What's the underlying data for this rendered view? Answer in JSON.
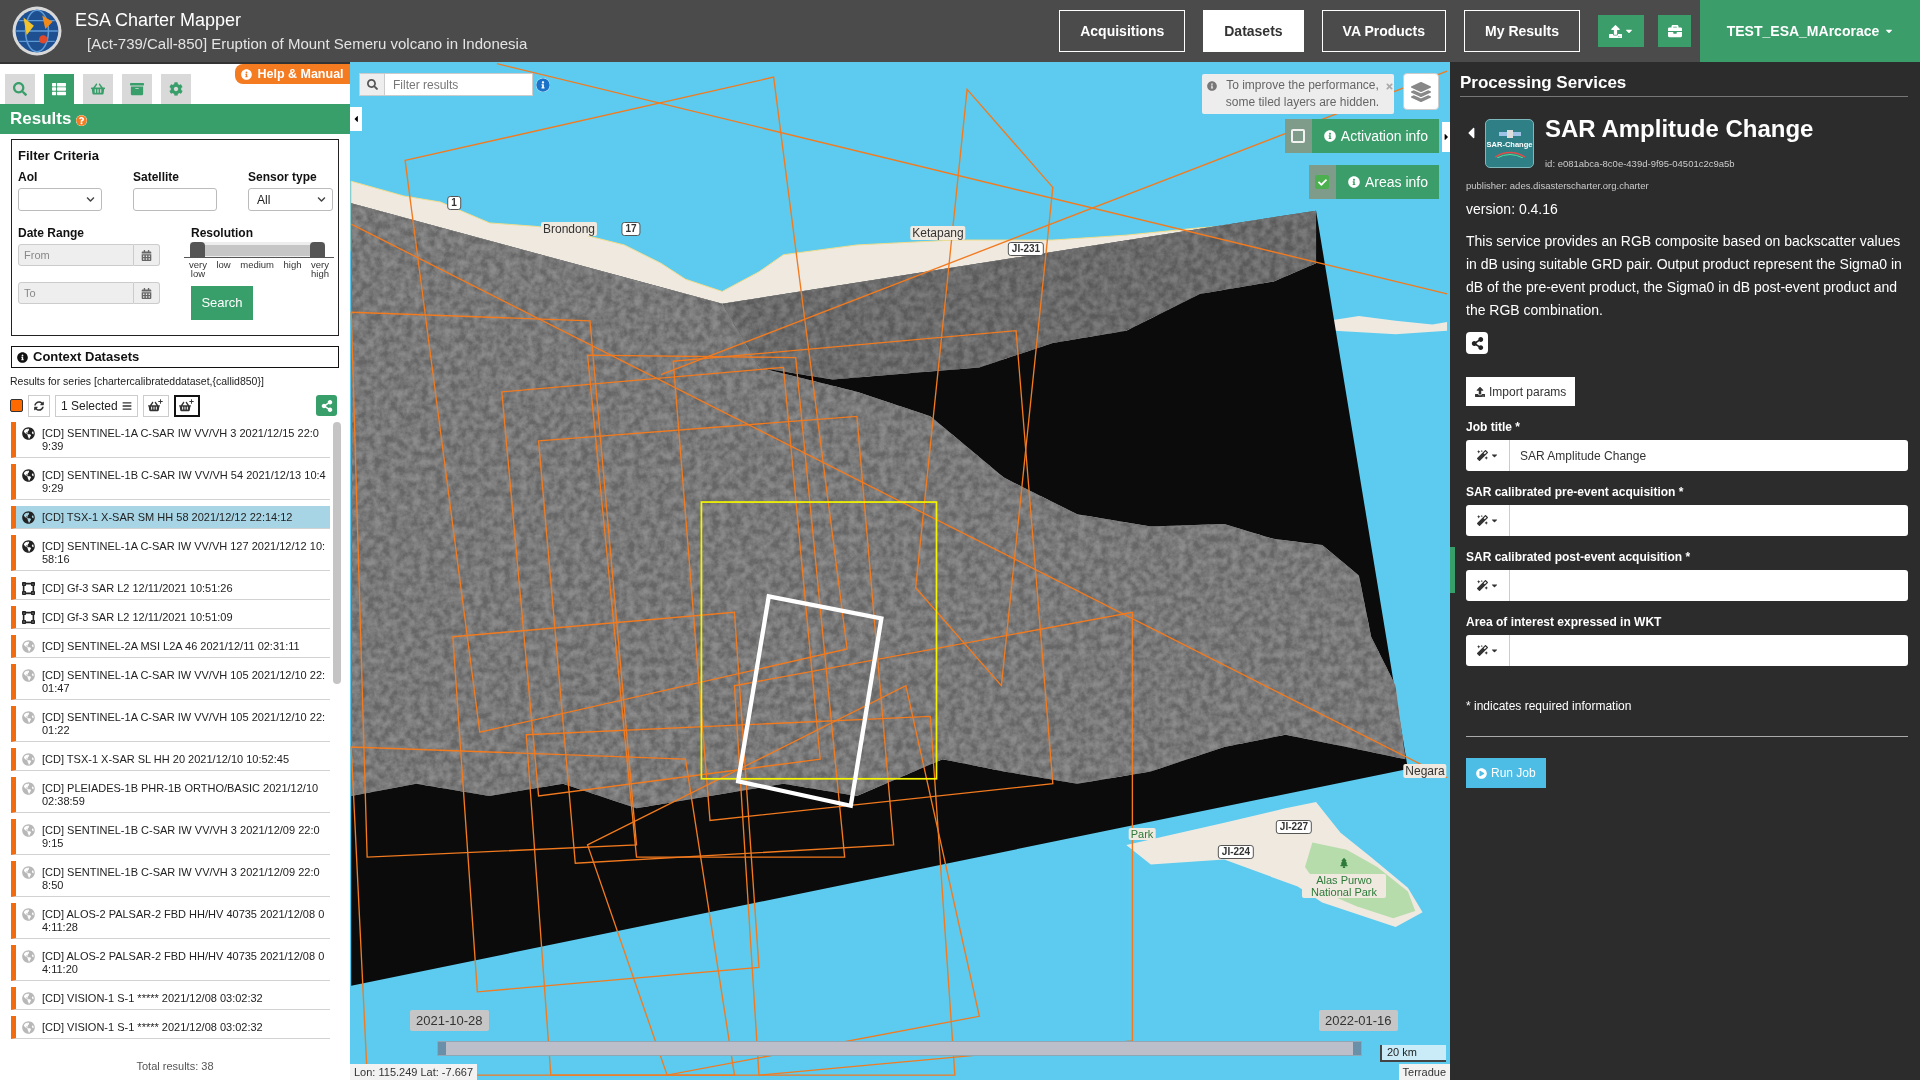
{
  "header": {
    "title": "ESA Charter Mapper",
    "subtitle": "[Act-739/Call-850] Eruption of Mount Semeru volcano in Indonesia",
    "nav": [
      {
        "label": "Acquisitions",
        "selected": false
      },
      {
        "label": "Datasets",
        "selected": true
      },
      {
        "label": "VA Products",
        "selected": false
      },
      {
        "label": "My Results",
        "selected": false
      }
    ],
    "user": "TEST_ESA_MArcorace"
  },
  "sidebar": {
    "help": "Help & Manual",
    "tabs": [
      {
        "kind": "search",
        "selected": false
      },
      {
        "kind": "list",
        "selected": true
      },
      {
        "kind": "basket",
        "selected": false
      },
      {
        "kind": "archive",
        "selected": false
      },
      {
        "kind": "settings",
        "selected": false
      }
    ],
    "heading": "Results",
    "filter": {
      "title": "Filter Criteria",
      "aoi": {
        "label": "AoI"
      },
      "satellite": {
        "label": "Satellite"
      },
      "sensor": {
        "label": "Sensor type",
        "value": "All"
      },
      "date_range": {
        "label": "Date Range",
        "from_placeholder": "From",
        "to_placeholder": "To"
      },
      "resolution": {
        "label": "Resolution",
        "level": 1,
        "ticks": [
          "very low",
          "low",
          "medium",
          "high",
          "very high"
        ]
      },
      "search_button": "Search"
    },
    "results": {
      "title": "Context Datasets",
      "series": "Results for series [chartercalibrateddataset,{callid850}]",
      "selected_count": "1 Selected",
      "basket_buttons": [
        {
          "focused": false
        },
        {
          "focused": true
        }
      ],
      "items": [
        {
          "text": "[CD] SENTINEL-1A C-SAR IW VV/VH 3 2021/12/15 22:09:39",
          "kind": "globe",
          "dimmed": false,
          "selected": false
        },
        {
          "text": "[CD] SENTINEL-1B C-SAR IW VV/VH 54 2021/12/13 10:49:29",
          "kind": "globe",
          "dimmed": false,
          "selected": false
        },
        {
          "text": "[CD] TSX-1 X-SAR SM HH 58 2021/12/12 22:14:12",
          "kind": "globe",
          "dimmed": false,
          "selected": true
        },
        {
          "text": "[CD] SENTINEL-1A C-SAR IW VV/VH 127 2021/12/12 10:58:16",
          "kind": "globe",
          "dimmed": false,
          "selected": false
        },
        {
          "text": "[CD] Gf-3 SAR L2 12/11/2021 10:51:26",
          "kind": "frame",
          "dimmed": false,
          "selected": false
        },
        {
          "text": "[CD] Gf-3 SAR L2 12/11/2021 10:51:09",
          "kind": "frame",
          "dimmed": false,
          "selected": false
        },
        {
          "text": "[CD] SENTINEL-2A MSI L2A 46 2021/12/11 02:31:11",
          "kind": "globe",
          "dimmed": true,
          "selected": false
        },
        {
          "text": "[CD] SENTINEL-1A C-SAR IW VV/VH 105 2021/12/10 22:01:47",
          "kind": "globe",
          "dimmed": true,
          "selected": false
        },
        {
          "text": "[CD] SENTINEL-1A C-SAR IW VV/VH 105 2021/12/10 22:01:22",
          "kind": "globe",
          "dimmed": true,
          "selected": false
        },
        {
          "text": "[CD] TSX-1 X-SAR SL HH 20 2021/12/10 10:52:45",
          "kind": "globe",
          "dimmed": true,
          "selected": false
        },
        {
          "text": "[CD] PLEIADES-1B PHR-1B ORTHO/BASIC 2021/12/10 02:38:59",
          "kind": "globe",
          "dimmed": true,
          "selected": false
        },
        {
          "text": "[CD] SENTINEL-1B C-SAR IW VV/VH 3 2021/12/09 22:09:15",
          "kind": "globe",
          "dimmed": true,
          "selected": false
        },
        {
          "text": "[CD] SENTINEL-1B C-SAR IW VV/VH 3 2021/12/09 22:08:50",
          "kind": "globe",
          "dimmed": true,
          "selected": false
        },
        {
          "text": "[CD] ALOS-2 PALSAR-2 FBD HH/HV 40735 2021/12/08 04:11:28",
          "kind": "globe",
          "dimmed": true,
          "selected": false
        },
        {
          "text": "[CD] ALOS-2 PALSAR-2 FBD HH/HV 40735 2021/12/08 04:11:20",
          "kind": "globe",
          "dimmed": true,
          "selected": false
        },
        {
          "text": "[CD] VISION-1 S-1 ***** 2021/12/08 03:02:32",
          "kind": "globe",
          "dimmed": true,
          "selected": false
        },
        {
          "text": "[CD] VISION-1 S-1 ***** 2021/12/08 03:02:32",
          "kind": "globe",
          "dimmed": true,
          "selected": false
        }
      ],
      "total": "Total results: 38"
    }
  },
  "map": {
    "filter_placeholder": "Filter results",
    "notice": "To improve the performance, some tiled layers are hidden.",
    "toggles": [
      {
        "label": "Activation info",
        "checked": false
      },
      {
        "label": "Areas info",
        "checked": true
      }
    ],
    "labels": [
      {
        "kind": "road",
        "text": "1"
      },
      {
        "kind": "place",
        "text": "Brondong"
      },
      {
        "kind": "road",
        "text": "17"
      },
      {
        "kind": "place",
        "text": "Ketapang"
      },
      {
        "kind": "road",
        "text": "JI-231"
      },
      {
        "kind": "place",
        "text": "Negara"
      },
      {
        "kind": "road",
        "text": "JI-227"
      },
      {
        "kind": "park",
        "text": "Park"
      },
      {
        "kind": "road",
        "text": "JI-224"
      },
      {
        "kind": "park",
        "text": "Alas Purwo National Park"
      }
    ],
    "timeline": {
      "start": "2021-10-28",
      "end": "2022-01-16",
      "level": 1
    },
    "scale": "20 km",
    "coordinates": "Lon: 115.249 Lat: -7.667",
    "attribution": "Terradue"
  },
  "panel": {
    "title": "Processing Services",
    "service": {
      "name": "SAR Amplitude Change",
      "thumbnail_label": "SAR-Change",
      "id": "id: e081abca-8c0e-439d-9f95-04501c2c9a5b",
      "publisher": "publisher: ades.disasterscharter.org.charter",
      "version": "version: 0.4.16",
      "description": "This service provides an RGB composite based on backscatter values in dB using suitable GRD pair. Output product represent the Sigma0 in dB of the pre-event product, the Sigma0 in dB post-event product and the RGB combination."
    },
    "import_button": "Import params",
    "fields": [
      {
        "label": "Job title *",
        "value": "SAR Amplitude Change"
      },
      {
        "label": "SAR calibrated pre-event acquisition *"
      },
      {
        "label": "SAR calibrated post-event acquisition *"
      },
      {
        "label": "Area of interest expressed in WKT"
      }
    ],
    "note": "* indicates required information",
    "run_button": "Run Job"
  }
}
